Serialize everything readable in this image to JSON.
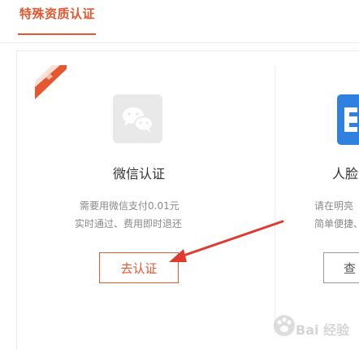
{
  "tab": {
    "label": "特殊资质认证"
  },
  "cards": {
    "wechat": {
      "title": "微信认证",
      "desc_line1": "需要用微信支付0.01元",
      "desc_line2": "实时通过、费用即时退还",
      "button_label": "去认证"
    },
    "face": {
      "title": "人脸",
      "desc_line1": "请在明亮",
      "desc_line2": "简单便捷、",
      "button_label": "查"
    }
  },
  "watermark": {
    "text": "Bai 经验"
  },
  "colors": {
    "accent": "#e5572e",
    "muted": "#8a8a8a",
    "face_blue": "#2f80e0"
  }
}
